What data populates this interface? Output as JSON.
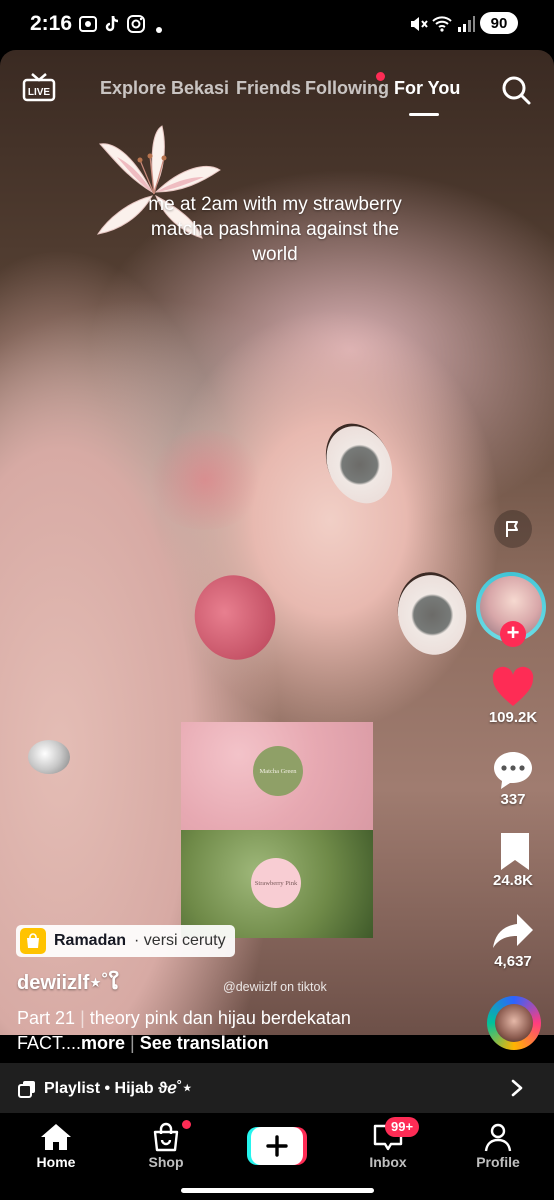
{
  "status_bar": {
    "time": "2:16",
    "battery": "90"
  },
  "top_nav": {
    "live_label": "LIVE",
    "tabs": [
      "Explore",
      "Bekasi",
      "Friends",
      "Following",
      "For You"
    ],
    "active_tab": "For You"
  },
  "video": {
    "overlay_caption": "me at 2am with my strawberry matcha pashmina against the world",
    "swatch_top_label": "Matcha Green",
    "swatch_bottom_label": "Strawberry Pink",
    "watermark": "@dewiizlf on tiktok"
  },
  "right_rail": {
    "likes": "109.2K",
    "comments": "337",
    "saves": "24.8K",
    "shares": "4,637",
    "like_color": "#fe2c55"
  },
  "post": {
    "anchor_title": "Ramadan",
    "anchor_subtitle": "· versi ceruty",
    "username": "dewiizlf⋆˚ໃ",
    "caption_part": "Part 21",
    "caption_text": "theory pink dan hijau berdekatan",
    "caption_line2": "FACT....",
    "more_label": "more",
    "see_translation": "See translation"
  },
  "playlist": {
    "label": "Playlist • Hijab ϑℯ˚⋆"
  },
  "bottom_nav": {
    "home": "Home",
    "shop": "Shop",
    "inbox": "Inbox",
    "inbox_badge": "99+",
    "profile": "Profile",
    "active": "Home"
  },
  "colors": {
    "accent": "#fe2c55",
    "create_left": "#25f4ee",
    "create_right": "#fe2c55"
  }
}
